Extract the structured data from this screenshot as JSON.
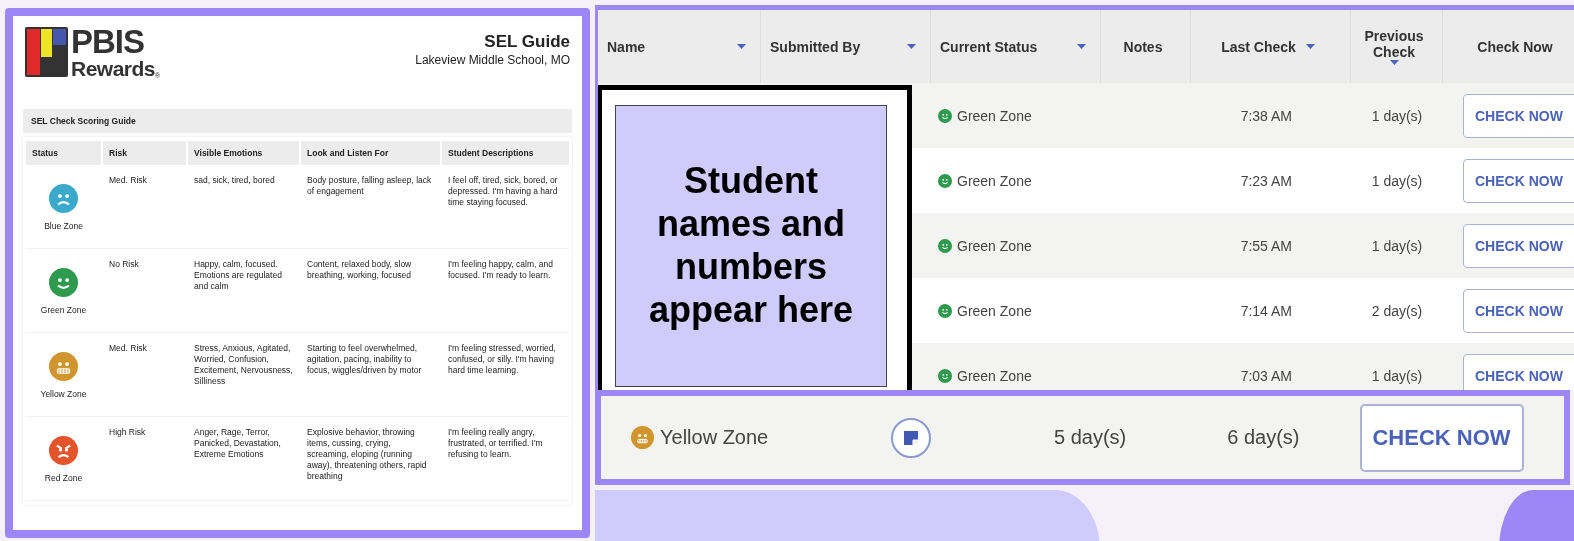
{
  "guide": {
    "logo": {
      "line1": "PBIS",
      "line2": "Rewards",
      "mark": "®"
    },
    "title": "SEL Guide",
    "school": "Lakeview Middle School, MO",
    "section_title": "SEL Check Scoring Guide",
    "columns": [
      "Status",
      "Risk",
      "Visible Emotions",
      "Look and Listen For",
      "Student Descriptions"
    ],
    "rows": [
      {
        "kind": "sad",
        "color": "#3aa9cc",
        "zone": "Blue Zone",
        "risk": "Med. Risk",
        "emotions": "sad, sick, tired, bored",
        "look_for": "Body posture, falling asleep, lack of engagement",
        "description": "I feel off, tired, sick, bored, or depressed. I'm having a hard time staying focused."
      },
      {
        "kind": "smile",
        "color": "#2e9a4e",
        "zone": "Green Zone",
        "risk": "No Risk",
        "emotions": "Happy, calm, focused. Emotions are regulated and calm",
        "look_for": "Content, relaxed body, slow breathing, working, focused",
        "description": "I'm feeling happy, calm, and focused. I'm ready to learn."
      },
      {
        "kind": "grimace",
        "color": "#d0952d",
        "zone": "Yellow Zone",
        "risk": "Med. Risk",
        "emotions": "Stress, Anxious, Agitated, Worried, Confusion, Excitement, Nervousness, Silliness",
        "look_for": "Starting to feel overwhelmed, agitation, pacing, inability to focus, wiggles/driven by motor",
        "description": "I'm feeling stressed, worried, confused, or silly. I'm having hard time learning."
      },
      {
        "kind": "angry",
        "color": "#e5532a",
        "zone": "Red Zone",
        "risk": "High Risk",
        "emotions": "Anger, Rage, Terror, Panicked, Devastation, Extreme Emotions",
        "look_for": "Explosive behavior, throwing items, cussing, crying, screaming, eloping (running away), threatening others, rapid breathing",
        "description": "I'm feeling really angry, frustrated, or terrified. I'm refusing to learn."
      }
    ]
  },
  "table": {
    "columns": [
      {
        "label": "Name",
        "sortable": true
      },
      {
        "label": "Submitted By",
        "sortable": true
      },
      {
        "label": "Current Status",
        "sortable": true
      },
      {
        "label": "Notes",
        "sortable": false
      },
      {
        "label": "Last Check",
        "sortable": true
      },
      {
        "label": "Previous Check",
        "sortable": true
      },
      {
        "label": "Check Now",
        "sortable": false
      }
    ],
    "rows": [
      {
        "status": "Green Zone",
        "color": "#2e9a4e",
        "last_check": "7:38 AM",
        "previous_check": "1 day(s)",
        "action": "CHECK NOW"
      },
      {
        "status": "Green Zone",
        "color": "#2e9a4e",
        "last_check": "7:23 AM",
        "previous_check": "1 day(s)",
        "action": "CHECK NOW"
      },
      {
        "status": "Green Zone",
        "color": "#2e9a4e",
        "last_check": "7:55 AM",
        "previous_check": "1 day(s)",
        "action": "CHECK NOW"
      },
      {
        "status": "Green Zone",
        "color": "#2e9a4e",
        "last_check": "7:14 AM",
        "previous_check": "2 day(s)",
        "action": "CHECK NOW"
      },
      {
        "status": "Green Zone",
        "color": "#2e9a4e",
        "last_check": "7:03 AM",
        "previous_check": "1 day(s)",
        "action": "CHECK NOW"
      }
    ],
    "overlay_note": "Student names and numbers appear here"
  },
  "focus_row": {
    "status": "Yellow Zone",
    "color": "#d0952d",
    "values": [
      "5 day(s)",
      "6 day(s)"
    ],
    "action": "CHECK NOW"
  }
}
